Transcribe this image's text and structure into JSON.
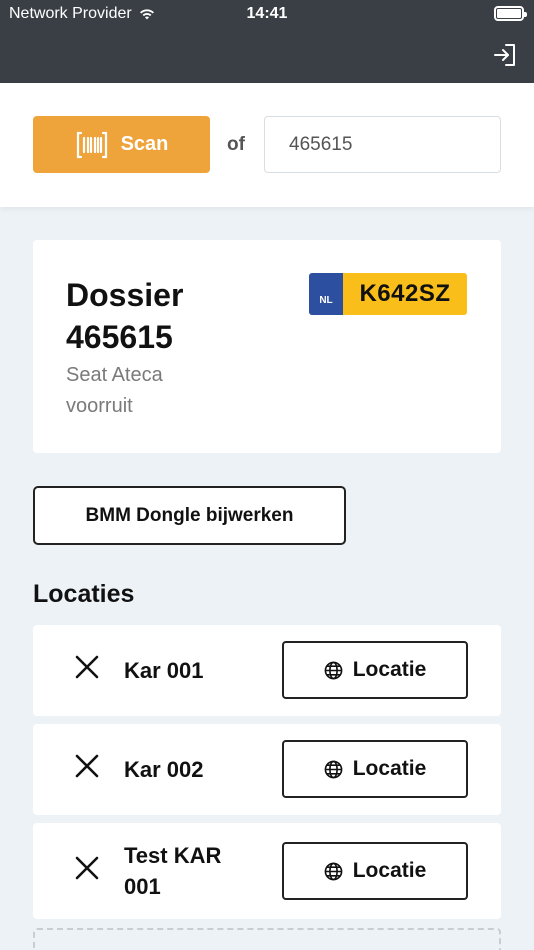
{
  "status_bar": {
    "carrier": "Network Provider",
    "time": "14:41"
  },
  "scan": {
    "button_label": "Scan",
    "or_label": "of",
    "input_value": "465615"
  },
  "dossier": {
    "title": "Dossier 465615",
    "vehicle": "Seat Ateca",
    "part": "voorruit",
    "plate_country": "NL",
    "plate_number": "K642SZ"
  },
  "actions": {
    "bmm_label": "BMM Dongle bijwerken"
  },
  "locations": {
    "heading": "Locaties",
    "button_label": "Locatie",
    "items": [
      {
        "name": "Kar 001"
      },
      {
        "name": "Kar 002"
      },
      {
        "name": "Test KAR 001"
      }
    ]
  },
  "colors": {
    "header": "#3a3f45",
    "accent": "#eea33b",
    "plate_blue": "#2c4fa0",
    "plate_yellow": "#f9be19",
    "background": "#edf2f6"
  }
}
